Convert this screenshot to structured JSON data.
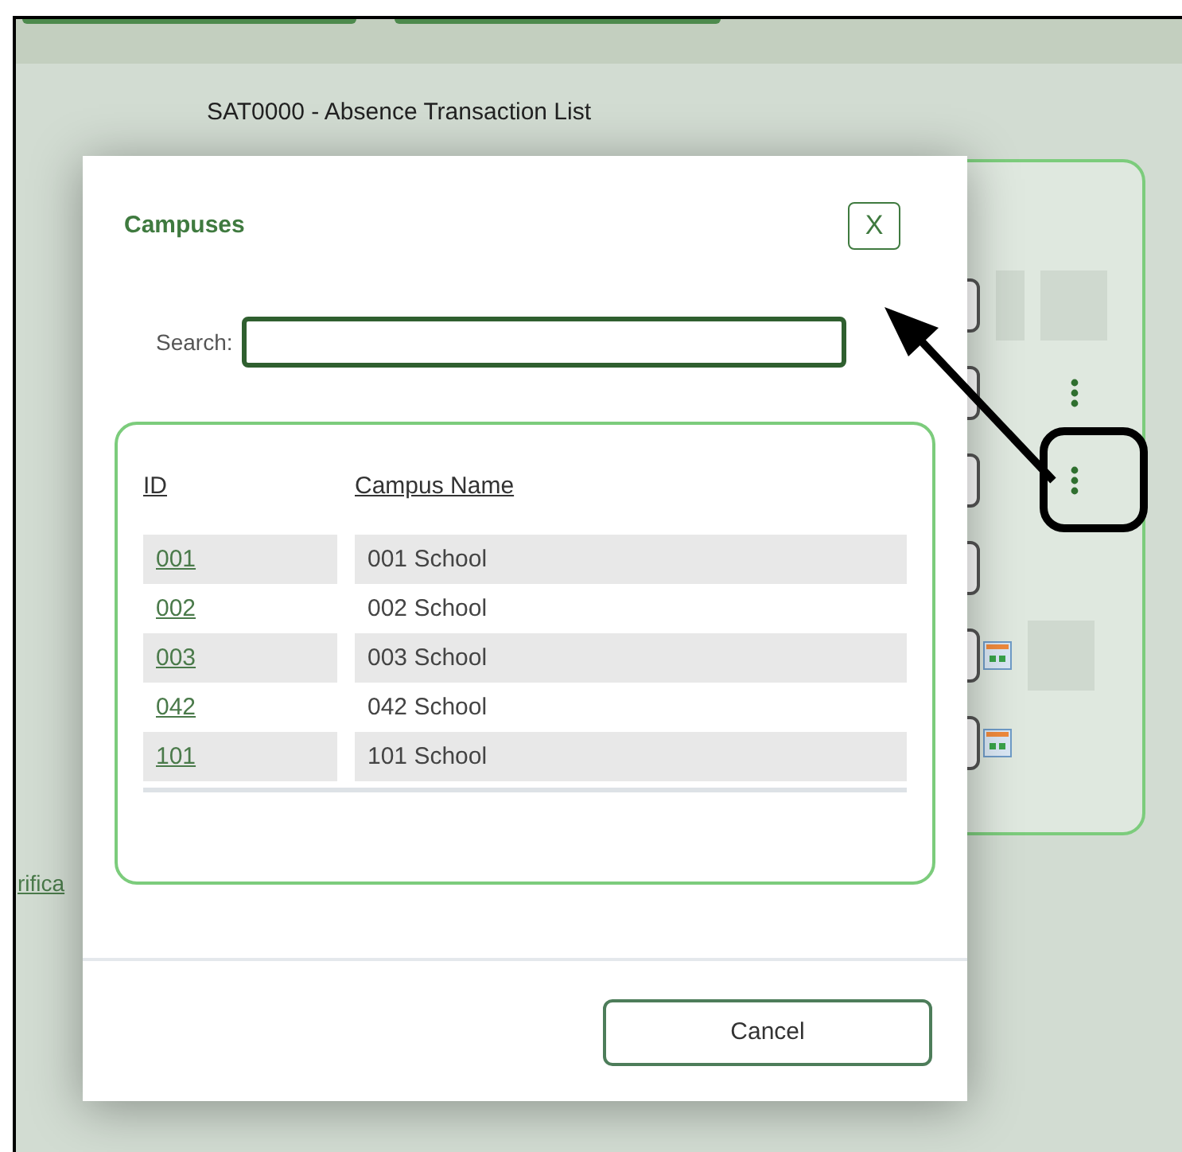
{
  "page": {
    "title": "SAT0000 - Absence Transaction List",
    "link": "rifica"
  },
  "panel_rows": [
    {
      "kind": "blank",
      "highlighted": false
    },
    {
      "kind": "menu",
      "highlighted": false
    },
    {
      "kind": "menu",
      "highlighted": true
    },
    {
      "kind": "plain",
      "highlighted": false
    },
    {
      "kind": "calendar",
      "highlighted": false
    },
    {
      "kind": "calendar",
      "highlighted": false
    }
  ],
  "dialog": {
    "title": "Campuses",
    "close": "X",
    "search": {
      "label": "Search:",
      "focused": true
    },
    "columns": [
      "ID",
      "Campus Name"
    ],
    "rows": [
      {
        "id": "001",
        "name": "001 School"
      },
      {
        "id": "002",
        "name": "002 School"
      },
      {
        "id": "003",
        "name": "003 School"
      },
      {
        "id": "042",
        "name": "042 School"
      },
      {
        "id": "101",
        "name": "101 School"
      }
    ],
    "buttons": [
      "Cancel"
    ]
  }
}
